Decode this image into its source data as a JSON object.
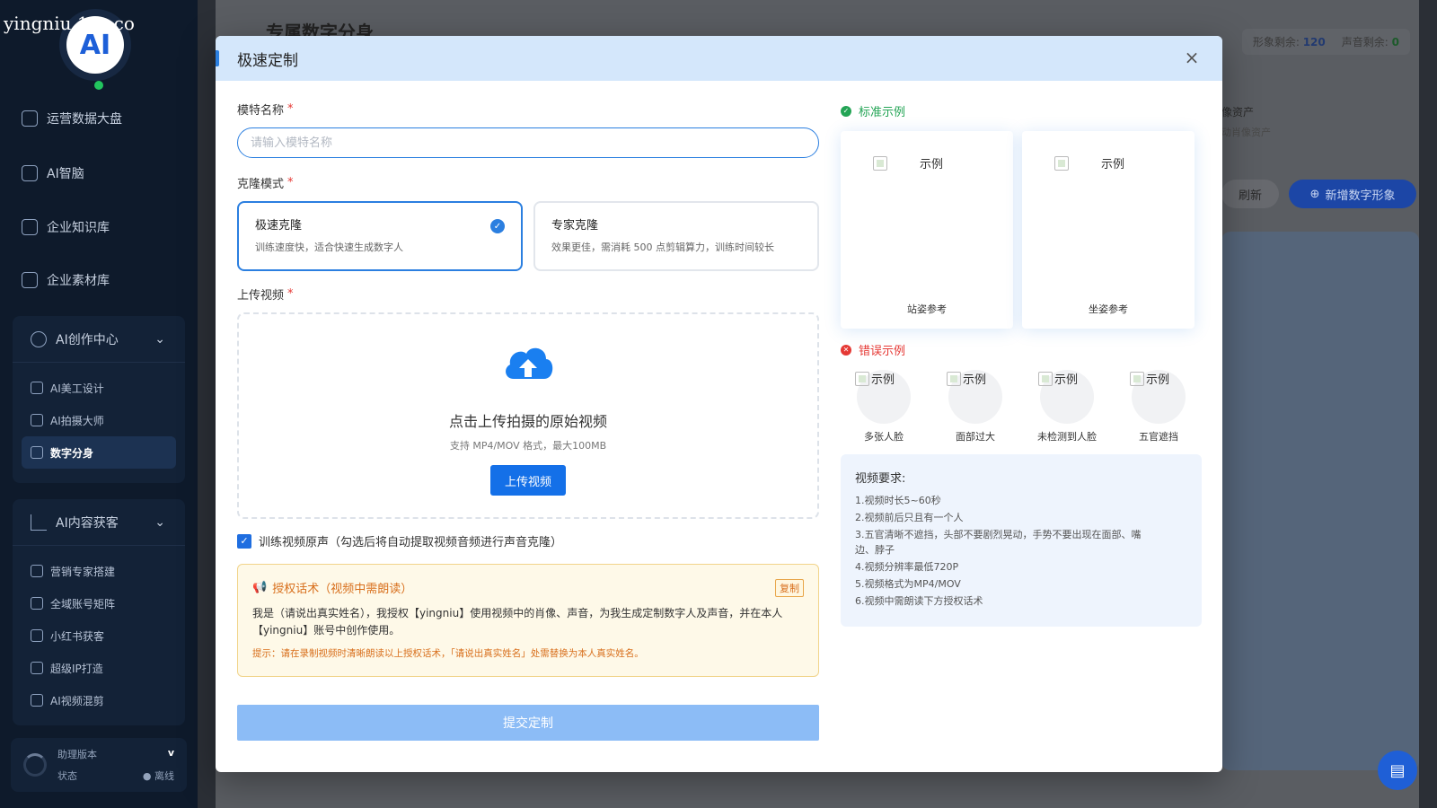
{
  "watermark": "yingniu.10v.co",
  "logo_text": "AI",
  "sidebar": {
    "items": [
      {
        "label": "运营数据大盘",
        "icon": "dashboard-icon"
      },
      {
        "label": "AI智脑",
        "icon": "brain-icon"
      },
      {
        "label": "企业知识库",
        "icon": "building-icon"
      },
      {
        "label": "企业素材库",
        "icon": "image-icon"
      }
    ],
    "group1": {
      "label": "AI创作中心",
      "items": [
        {
          "label": "AI美工设计"
        },
        {
          "label": "AI拍摄大师"
        },
        {
          "label": "数字分身"
        }
      ]
    },
    "group2": {
      "label": "AI内容获客",
      "items": [
        {
          "label": "营销专家搭建"
        },
        {
          "label": "全域账号矩阵"
        },
        {
          "label": "小红书获客"
        },
        {
          "label": "超级IP打造"
        },
        {
          "label": "AI视频混剪"
        }
      ]
    },
    "status": {
      "title": "助理版本",
      "subtitle": "状态",
      "state": "离线",
      "version": "v"
    }
  },
  "background": {
    "page_title": "专属数字分身",
    "image_quota_label": "形象剩余:",
    "image_quota_value": "120",
    "voice_quota_label": "声音剩余:",
    "voice_quota_value": "0",
    "asset_title": "像资产",
    "asset_sub": "动肖像资产",
    "refresh_label": "刷新",
    "add_label": "新增数字形象"
  },
  "modal": {
    "title": "极速定制",
    "name_label": "模特名称",
    "name_placeholder": "请输入模特名称",
    "name_value": "",
    "mode_label": "克隆模式",
    "modes": [
      {
        "name": "极速克隆",
        "desc": "训练速度快，适合快速生成数字人",
        "selected": true
      },
      {
        "name": "专家克隆",
        "desc": "效果更佳，需消耗 500 点剪辑算力，训练时间较长",
        "selected": false
      }
    ],
    "upload_label": "上传视频",
    "upload_title": "点击上传拍摄的原始视频",
    "upload_hint": "支持 MP4/MOV 格式，最大100MB",
    "upload_button": "上传视频",
    "train_audio_label": "训练视频原声（勾选后将自动提取视频音频进行声音克隆）",
    "train_audio_checked": true,
    "auth_title": "授权话术（视频中需朗读）",
    "copy_label": "复制",
    "auth_text": "我是（请说出真实姓名），我授权【yingniu】使用视频中的肖像、声音，为我生成定制数字人及声音，并在本人【yingniu】账号中创作使用。",
    "auth_tip": "提示：请在录制视频时清晰朗读以上授权话术，「请说出真实姓名」处需替换为本人真实姓名。",
    "submit_label": "提交定制",
    "standard_title": "标准示例",
    "standard_examples": [
      {
        "alt": "示例",
        "caption": "站姿参考"
      },
      {
        "alt": "示例",
        "caption": "坐姿参考"
      }
    ],
    "wrong_title": "错误示例",
    "wrong_examples": [
      {
        "alt": "示例",
        "caption": "多张人脸"
      },
      {
        "alt": "示例",
        "caption": "面部过大"
      },
      {
        "alt": "示例",
        "caption": "未检测到人脸"
      },
      {
        "alt": "示例",
        "caption": "五官遮挡"
      }
    ],
    "requirements_title": "视频要求:",
    "requirements": [
      "1.视频时长5~60秒",
      "2.视频前后只且有一个人",
      "3.五官清晰不遮挡，头部不要剧烈晃动，手势不要出现在面部、嘴",
      "边、脖子",
      "4.视频分辨率最低720P",
      "5.视频格式为MP4/MOV",
      "6.视频中需朗读下方授权话术"
    ]
  },
  "colors": {
    "accent": "#2b7fe0",
    "success": "#23a455",
    "error": "#e53935",
    "warning": "#d86f1c"
  }
}
